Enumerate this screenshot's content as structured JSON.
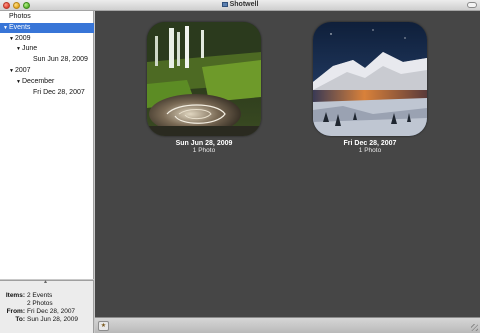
{
  "window": {
    "title": "Shotwell"
  },
  "sidebar": {
    "rows": [
      {
        "label": "Photos",
        "expander": "",
        "indent": 0,
        "selected": false
      },
      {
        "label": "Events",
        "expander": "▼",
        "indent": 0,
        "selected": true
      },
      {
        "label": "2009",
        "expander": "▼",
        "indent": 1,
        "selected": false
      },
      {
        "label": "June",
        "expander": "▼",
        "indent": 2,
        "selected": false
      },
      {
        "label": "Sun Jun 28, 2009",
        "expander": "",
        "indent": 3,
        "selected": false
      },
      {
        "label": "2007",
        "expander": "▼",
        "indent": 1,
        "selected": false
      },
      {
        "label": "December",
        "expander": "▼",
        "indent": 2,
        "selected": false
      },
      {
        "label": "Fri Dec 28, 2007",
        "expander": "",
        "indent": 3,
        "selected": false
      }
    ]
  },
  "info": {
    "rows": [
      {
        "label": "Items:",
        "value": "2 Events"
      },
      {
        "label": "",
        "value": "2 Photos"
      },
      {
        "label": "From:",
        "value": "Fri Dec 28, 2007"
      },
      {
        "label": "To:",
        "value": "Sun Jun 28, 2009"
      }
    ]
  },
  "events": [
    {
      "date": "Sun Jun 28, 2009",
      "count": "1 Photo",
      "thumbnail": "waterfall-photo"
    },
    {
      "date": "Fri Dec 28, 2007",
      "count": "1 Photo",
      "thumbnail": "mountain-sunset-photo"
    }
  ],
  "statusbar": {
    "button_icon": "event-icon"
  }
}
